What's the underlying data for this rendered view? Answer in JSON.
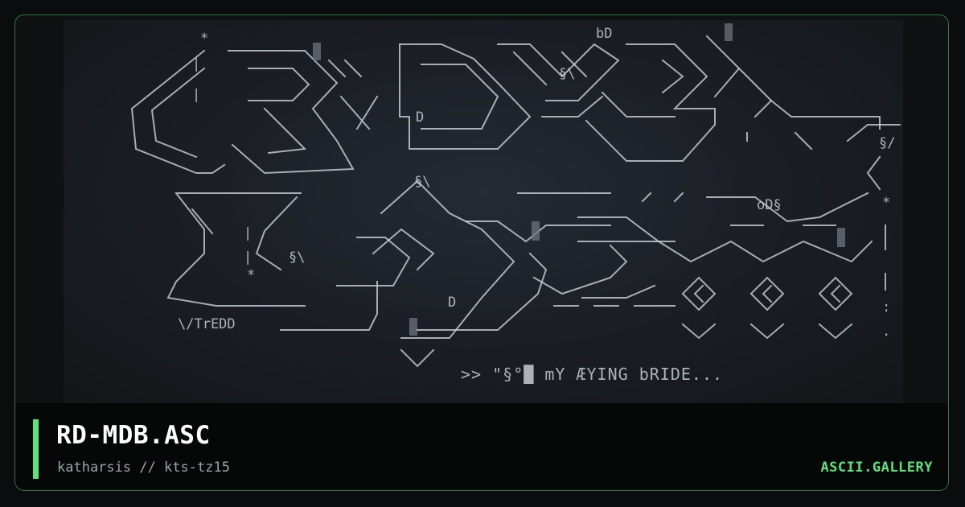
{
  "artwork": {
    "caption": ">> \"§°█ mY ÆYING bRIDE...",
    "signature": "\\/TrEDD",
    "tags": [
      "bD",
      "§\\",
      "§\\",
      "D",
      "D",
      "§/",
      "oD§",
      "§\\"
    ]
  },
  "footer": {
    "title": "RD-MDB.ASC",
    "subtitle": "katharsis // kts-tz15",
    "brand": "ASCII.GALLERY"
  },
  "colors": {
    "accent": "#5ee07a",
    "border": "#2f7a3a",
    "art_background": "#1a1d23",
    "art_ink": "#c8cdd3"
  }
}
